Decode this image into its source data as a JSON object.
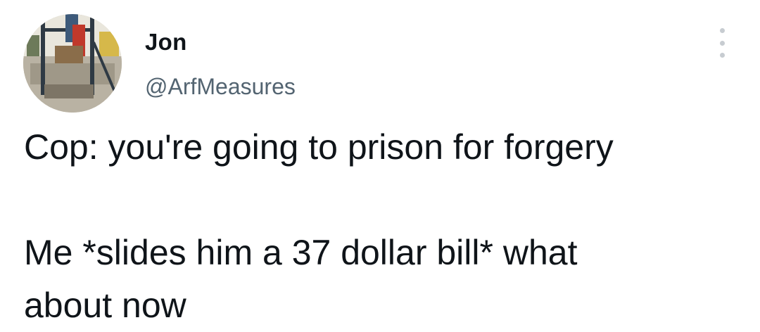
{
  "author": {
    "display_name": "Jon",
    "handle": "@ArfMeasures",
    "avatar_icon": "profile-photo"
  },
  "tweet": {
    "line_1": "Cop: you're going to prison for forgery",
    "line_2": "",
    "line_3": "Me *slides him a 37 dollar bill* what",
    "line_4": "about now"
  },
  "colors": {
    "text": "#0f1419",
    "secondary": "#536471",
    "menu_dots": "#c7ccd1"
  }
}
